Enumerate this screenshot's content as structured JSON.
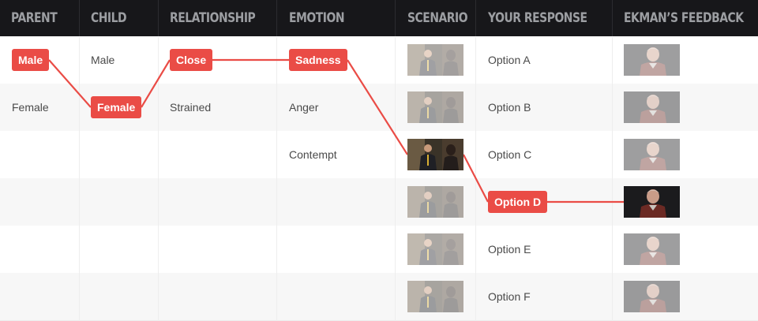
{
  "header": {
    "columns": [
      "Parent",
      "Child",
      "Relationship",
      "Emotion",
      "Scenario",
      "Your Response",
      "Ekman’s Feedback"
    ]
  },
  "rows": [
    {
      "parent": "Male",
      "child": "Male",
      "relationship": "Close",
      "emotion": "Sadness",
      "response": "Option A"
    },
    {
      "parent": "Female",
      "child": "Female",
      "relationship": "Strained",
      "emotion": "Anger",
      "response": "Option B"
    },
    {
      "parent": "",
      "child": "",
      "relationship": "",
      "emotion": "Contempt",
      "response": "Option C"
    },
    {
      "parent": "",
      "child": "",
      "relationship": "",
      "emotion": "",
      "response": "Option D"
    },
    {
      "parent": "",
      "child": "",
      "relationship": "",
      "emotion": "",
      "response": "Option E"
    },
    {
      "parent": "",
      "child": "",
      "relationship": "",
      "emotion": "",
      "response": "Option F"
    }
  ],
  "selection": {
    "parent_row": 0,
    "child_row": 1,
    "relationship_row": 0,
    "emotion_row": 0,
    "scenario_row": 2,
    "response_row": 3,
    "feedback_row": 3
  },
  "colors": {
    "accent": "#ea4c46",
    "header_bg": "#17171a",
    "header_text": "#9c9ea2",
    "body_text": "#4a4a4a"
  },
  "icons": {
    "scenario_thumb": "scenario-video-thumbnail",
    "feedback_thumb": "ekman-feedback-video-thumbnail"
  }
}
